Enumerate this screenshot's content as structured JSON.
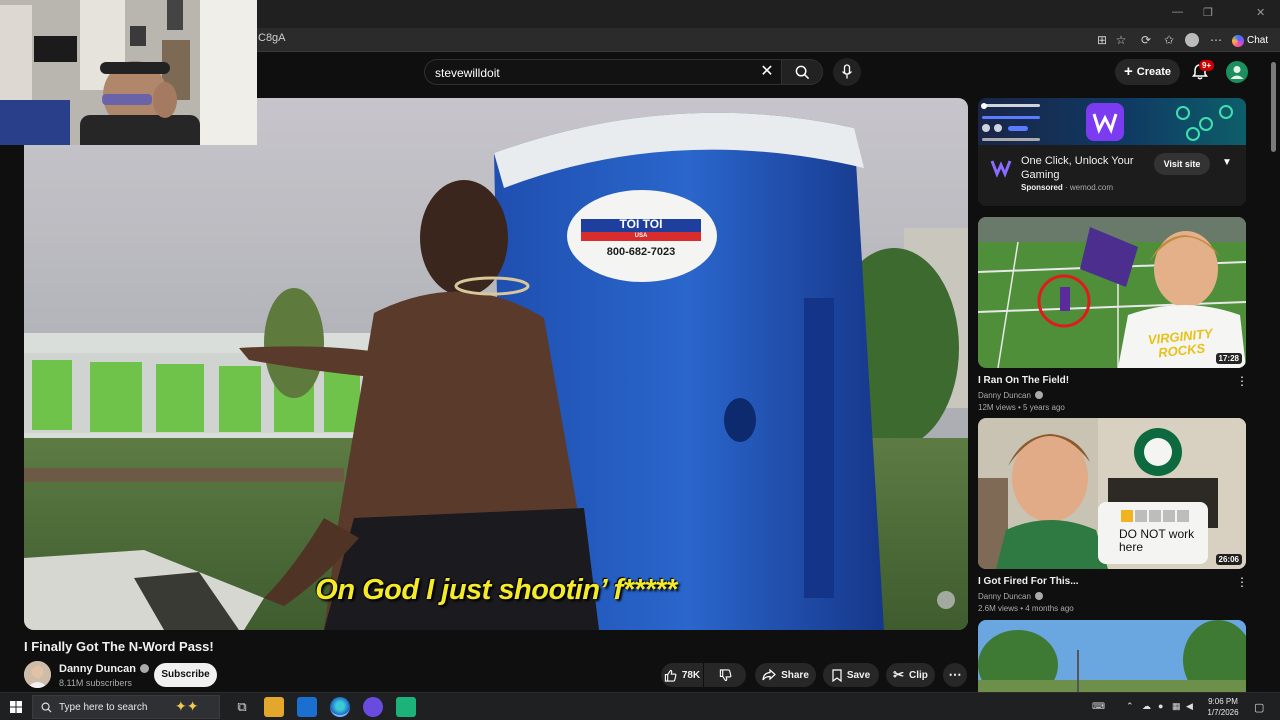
{
  "browser": {
    "url_fragment": "C8gA",
    "chat_label": "Chat"
  },
  "header": {
    "search_value": "stevewilldoit",
    "create_label": "Create",
    "notification_badge": "9+"
  },
  "video": {
    "caption": "On God I just shootin’ f*****",
    "toilet_brand": "TOI TOI",
    "toilet_sub": "USA",
    "toilet_phone": "800-682-7023",
    "title": "I Finally Got The N-Word Pass!",
    "channel": "Danny Duncan",
    "subscribers": "8.11M subscribers",
    "subscribe_label": "Subscribe",
    "likes": "78K",
    "share_label": "Share",
    "save_label": "Save",
    "clip_label": "Clip"
  },
  "ad": {
    "title": "One Click, Unlock Your Gaming",
    "sponsored_label": "Sponsored",
    "domain": "wemod.com",
    "visit_label": "Visit site"
  },
  "related": [
    {
      "title": "I Ran On The Field!",
      "channel": "Danny Duncan",
      "meta": "12M views • 5 years ago",
      "duration": "17:28",
      "shirt_text": "VIRGINITY ROCKS"
    },
    {
      "title": "I Got Fired For This...",
      "channel": "Danny Duncan",
      "meta": "2.6M views • 4 months ago",
      "duration": "26:06",
      "sign_text": "DO NOT work here"
    }
  ],
  "taskbar": {
    "search_placeholder": "Type here to search",
    "time": "9:06 PM",
    "date": "1/7/2026"
  }
}
